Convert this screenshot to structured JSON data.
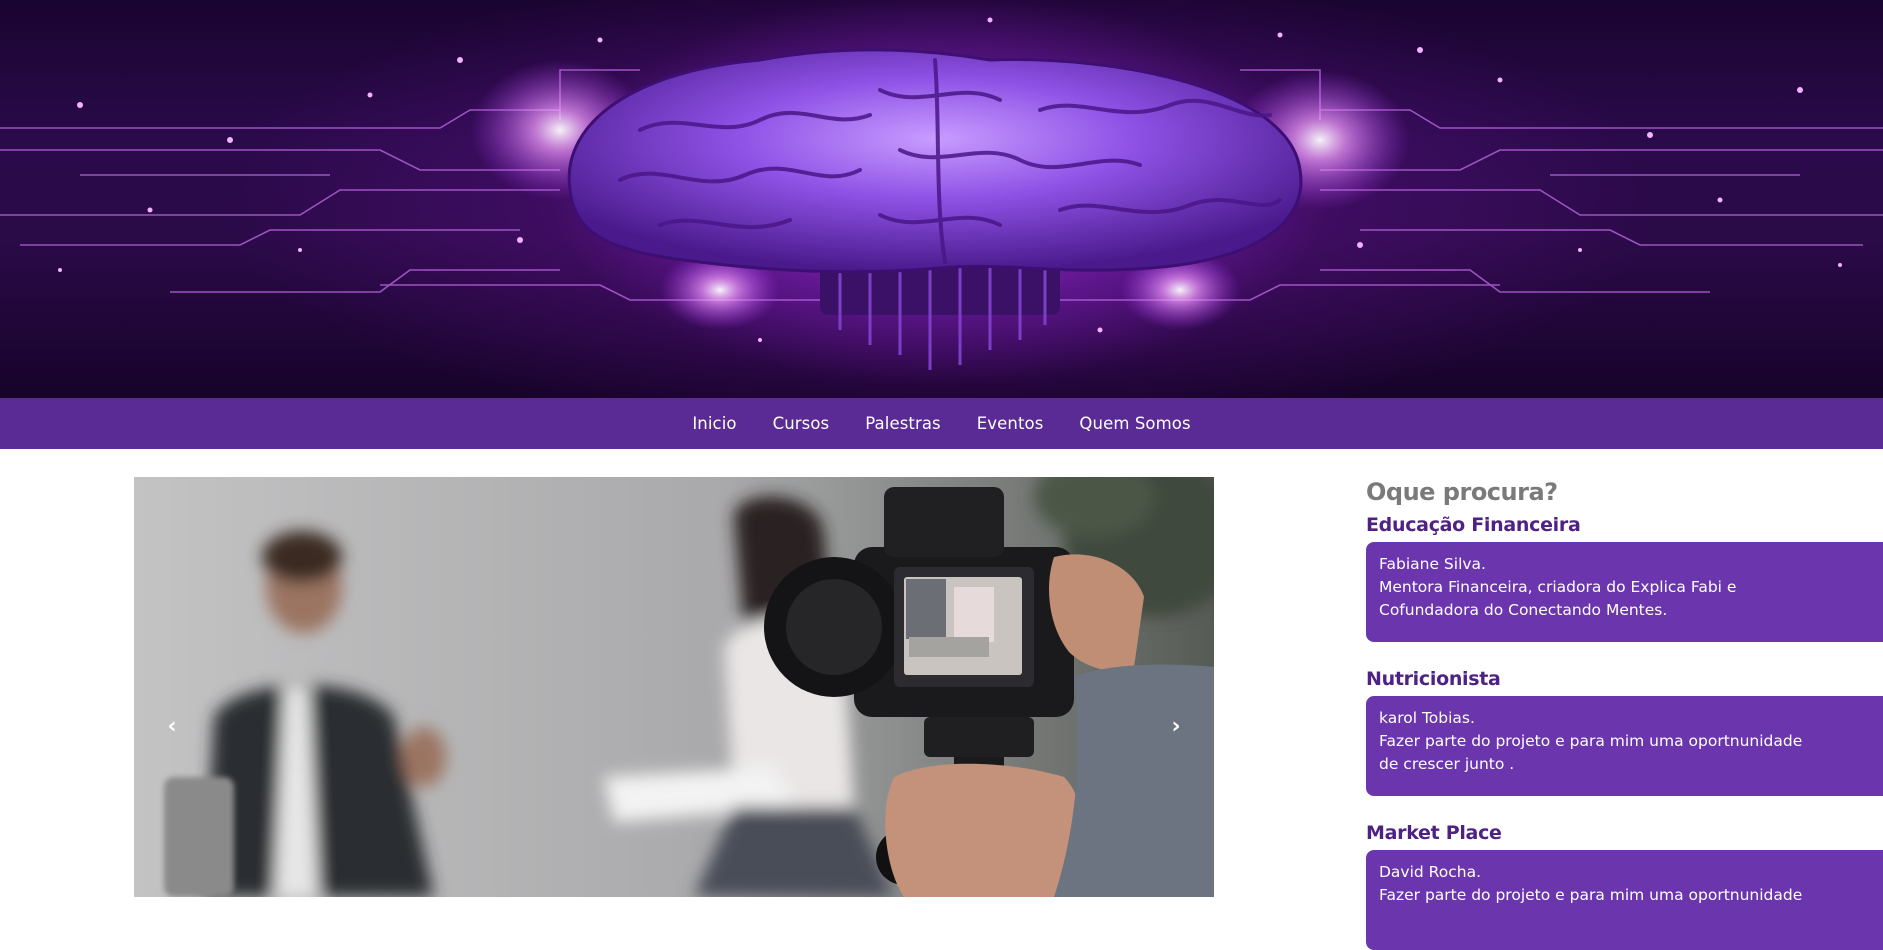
{
  "hero": {
    "image": "digital brain circuit banner (purple)"
  },
  "nav": {
    "items": [
      "Inicio",
      "Cursos",
      "Palestras",
      "Eventos",
      "Quem Somos"
    ]
  },
  "carousel": {
    "image": "camera filming interview scene",
    "prev_icon": "chevron-left-icon",
    "next_icon": "chevron-right-icon",
    "prev_glyph": "‹",
    "next_glyph": "›"
  },
  "sidebar": {
    "heading": "Oque procura?",
    "sections": [
      {
        "title": "Educação Financeira",
        "lines": [
          "Fabiane Silva.",
          "Mentora Financeira, criadora do Explica Fabi e",
          "Cofundadora do Conectando Mentes."
        ]
      },
      {
        "title": "Nutricionista",
        "lines": [
          "karol Tobias.",
          "Fazer parte do projeto e para mim uma oportnunidade",
          "de crescer junto ."
        ]
      },
      {
        "title": "Market Place",
        "lines": [
          "David Rocha.",
          "Fazer parte do projeto e para mim uma oportnunidade"
        ]
      }
    ]
  },
  "colors": {
    "nav_bg": "#5b2b95",
    "card_bg": "#6a35ad",
    "section_title": "#4e2184",
    "heading": "#7a7a7a"
  }
}
